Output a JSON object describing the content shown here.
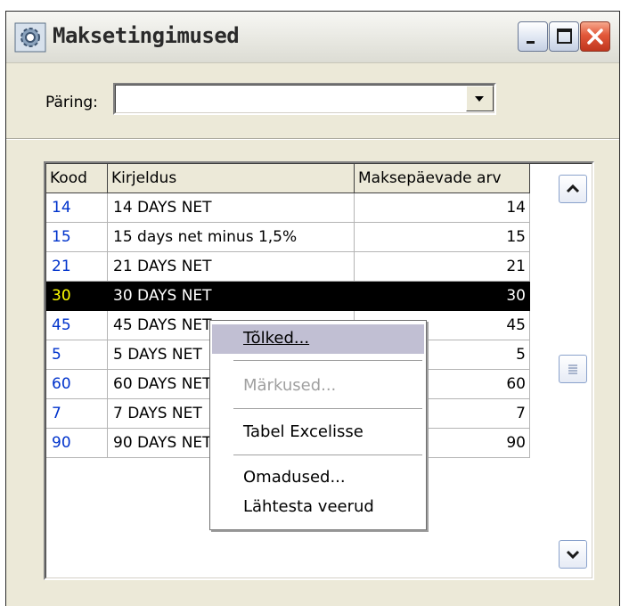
{
  "window": {
    "title": "Maksetingimused",
    "icon": "settings-gear-icon",
    "controls": [
      "minimize",
      "maximize",
      "close"
    ],
    "colors": {
      "close_button": "#e2583a",
      "selection": "#000000",
      "code_text": "#0033cc",
      "selected_code_text": "#ffff00"
    }
  },
  "query": {
    "label": "Päring:",
    "value": ""
  },
  "table": {
    "columns": [
      "Kood",
      "Kirjeldus",
      "Maksepäevade arv"
    ],
    "rows": [
      {
        "code": "14",
        "description": "14 DAYS NET",
        "days": "14"
      },
      {
        "code": "15",
        "description": "15 days net minus 1,5%",
        "days": "15"
      },
      {
        "code": "21",
        "description": "21 DAYS NET",
        "days": "21"
      },
      {
        "code": "30",
        "description": "30 DAYS NET",
        "days": "30",
        "selected": true
      },
      {
        "code": "45",
        "description": "45 DAYS NET",
        "days": "45"
      },
      {
        "code": "5",
        "description": "5 DAYS NET",
        "days": "5"
      },
      {
        "code": "60",
        "description": "60 DAYS NET",
        "days": "60"
      },
      {
        "code": "7",
        "description": "7 DAYS NET",
        "days": "7"
      },
      {
        "code": "90",
        "description": "90 DAYS NET",
        "days": "90"
      }
    ]
  },
  "context_menu": {
    "items": [
      {
        "label": "Tõlked...",
        "highlighted": true
      },
      {
        "label": "Märkused...",
        "disabled": true
      },
      {
        "label": "Tabel Excelisse"
      },
      {
        "label": "Omadused..."
      },
      {
        "label": "Lähtesta veerud"
      }
    ]
  }
}
